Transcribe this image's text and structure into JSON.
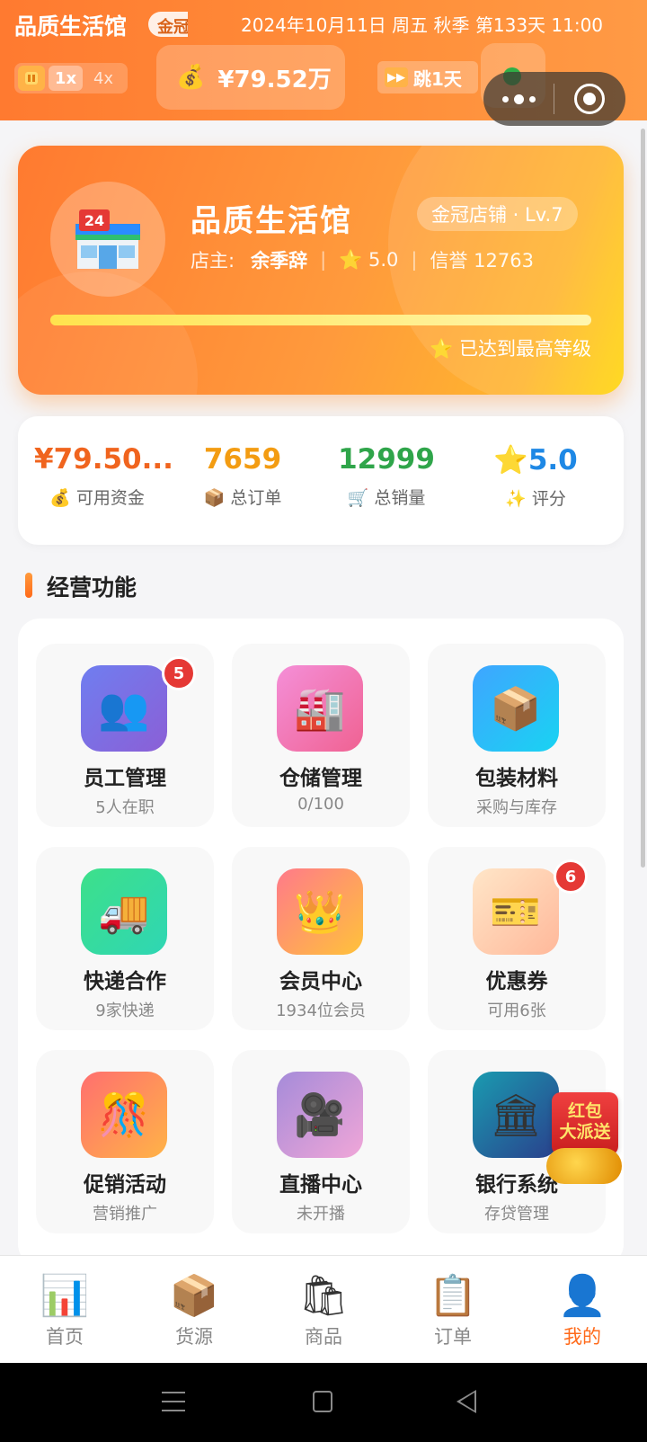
{
  "header": {
    "shop_name": "品质生活馆",
    "crown_tag": "金冠",
    "datetime": "2024年10月11日 周五 秋季 第133天 11:00",
    "speed": {
      "x1": "1x",
      "x4": "4x"
    },
    "money_icon": "💰",
    "money": "¥79.52万",
    "skip_label": "跳1天"
  },
  "shop_card": {
    "title": "品质生活馆",
    "level": "金冠店铺 · Lv.7",
    "owner_label": "店主:",
    "owner_name": "余季辞",
    "rating": "⭐ 5.0",
    "credit": "信誉 12763",
    "progress_percent": 100,
    "max_note": "⭐ 已达到最高等级"
  },
  "stats": [
    {
      "value": "¥79.50...",
      "label": "💰 可用资金",
      "color": "#f0641e"
    },
    {
      "value": "7659",
      "label": "📦 总订单",
      "color": "#f39c12"
    },
    {
      "value": "12999",
      "label": "🛒 总销量",
      "color": "#2fa54a"
    },
    {
      "value": "⭐5.0",
      "label": "✨ 评分",
      "color": "#1e88e5"
    }
  ],
  "section_title": "经营功能",
  "tiles": [
    {
      "icon": "👥",
      "name": "员工管理",
      "sub": "5人在职",
      "badge": "5"
    },
    {
      "icon": "🏭",
      "name": "仓储管理",
      "sub": "0/100"
    },
    {
      "icon": "📦",
      "name": "包装材料",
      "sub": "采购与库存"
    },
    {
      "icon": "🚚",
      "name": "快递合作",
      "sub": "9家快递"
    },
    {
      "icon": "👑",
      "name": "会员中心",
      "sub": "1934位会员"
    },
    {
      "icon": "🎫",
      "name": "优惠券",
      "sub": "可用6张",
      "badge": "6"
    },
    {
      "icon": "🎊",
      "name": "促销活动",
      "sub": "营销推广"
    },
    {
      "icon": "🎥",
      "name": "直播中心",
      "sub": "未开播"
    },
    {
      "icon": "🏛",
      "name": "银行系统",
      "sub": "存贷管理"
    }
  ],
  "hongbao": {
    "line1": "红包",
    "line2": "大派送"
  },
  "tabs": [
    {
      "icon": "📊",
      "label": "首页"
    },
    {
      "icon": "📦",
      "label": "货源"
    },
    {
      "icon": "🛍",
      "label": "商品"
    },
    {
      "icon": "📋",
      "label": "订单"
    },
    {
      "icon": "👤",
      "label": "我的"
    }
  ],
  "colors": {
    "accent": "#ff6a1a",
    "badge": "#e53935"
  }
}
